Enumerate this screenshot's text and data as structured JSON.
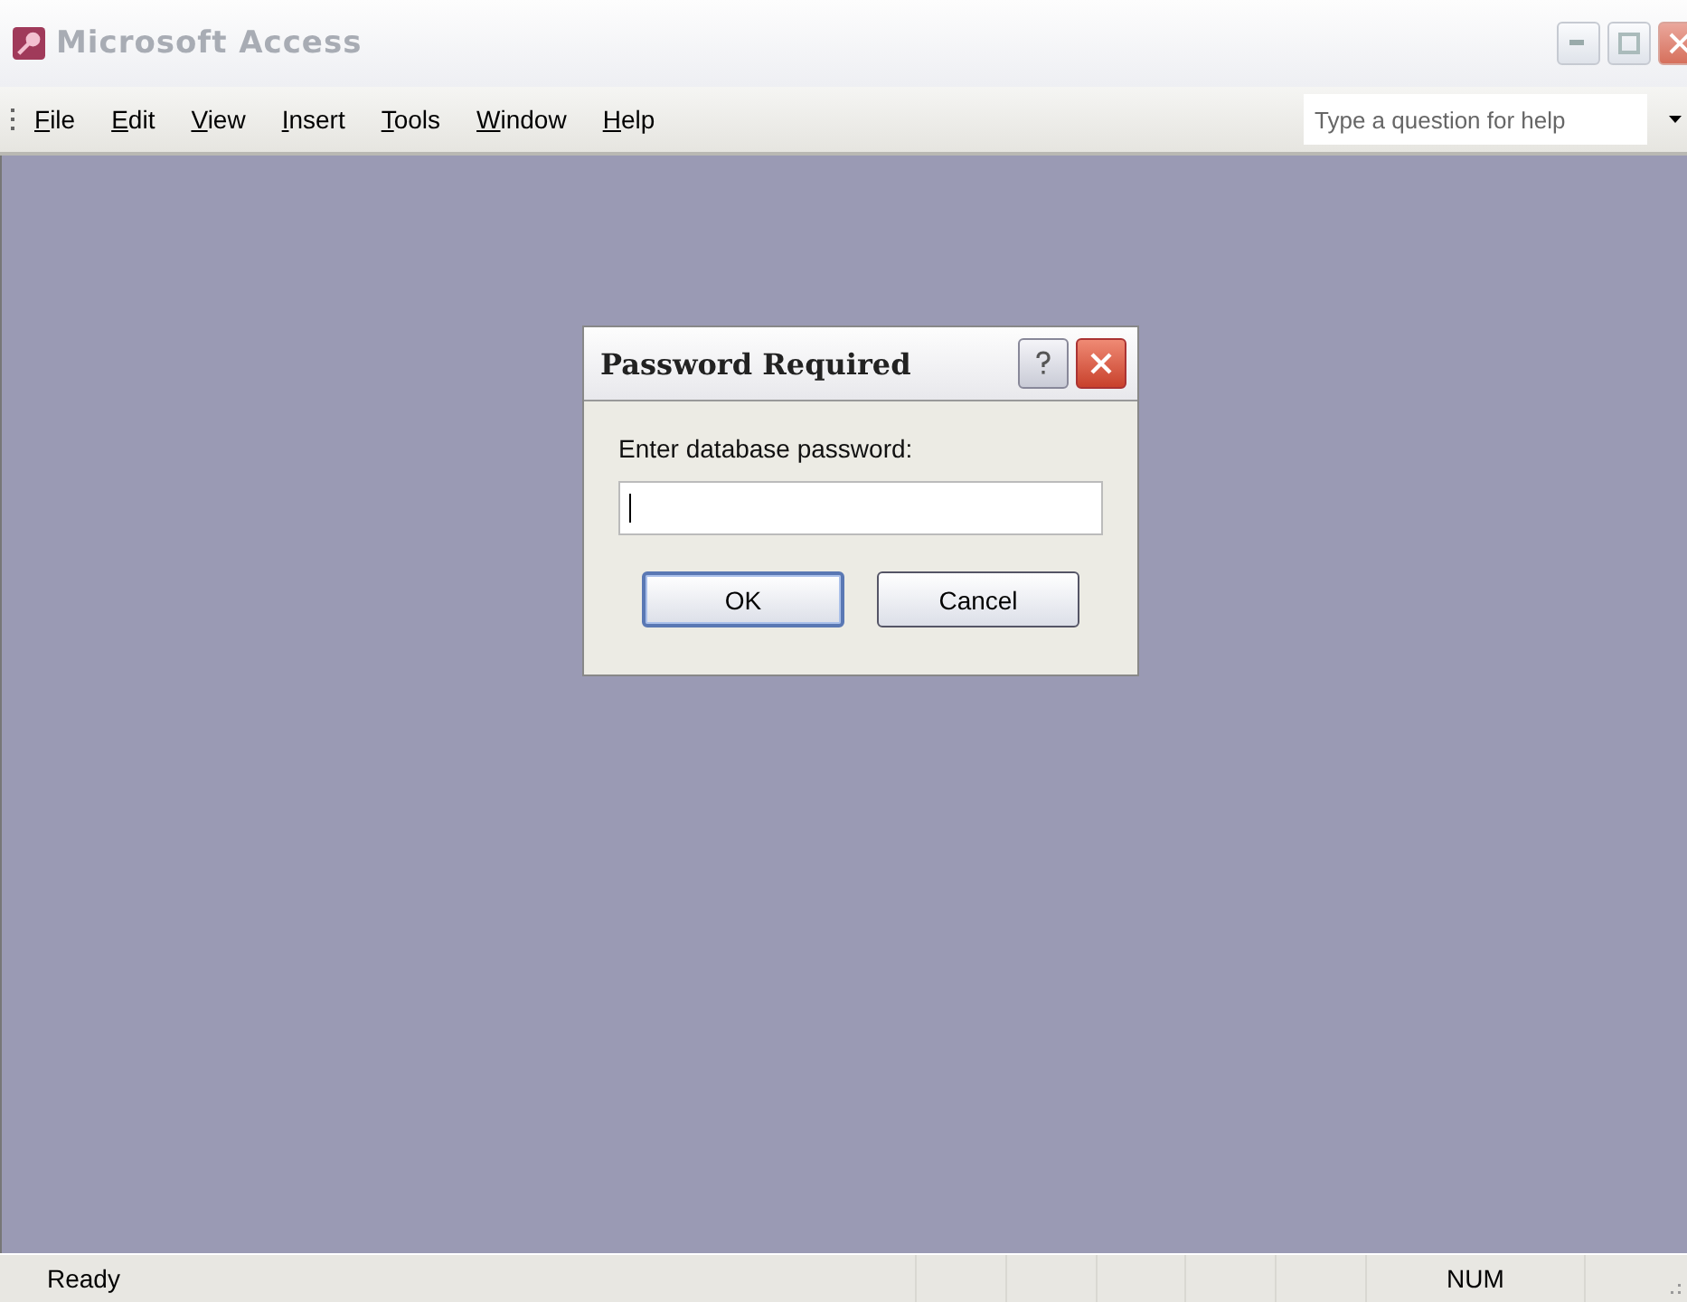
{
  "window": {
    "title": "Microsoft Access"
  },
  "menu": [
    {
      "label": "File"
    },
    {
      "label": "Edit"
    },
    {
      "label": "View"
    },
    {
      "label": "Insert"
    },
    {
      "label": "Tools"
    },
    {
      "label": "Window"
    },
    {
      "label": "Help"
    }
  ],
  "help_box": {
    "placeholder": "Type a question for help"
  },
  "dialog": {
    "title": "Password Required",
    "prompt": "Enter database password:",
    "buttons": [
      {
        "label": "OK",
        "selected": true
      },
      {
        "label": "Cancel",
        "selected": false
      }
    ]
  },
  "status_bar": {
    "text": "Ready",
    "indicators": [
      {
        "label": "NUM"
      }
    ]
  }
}
